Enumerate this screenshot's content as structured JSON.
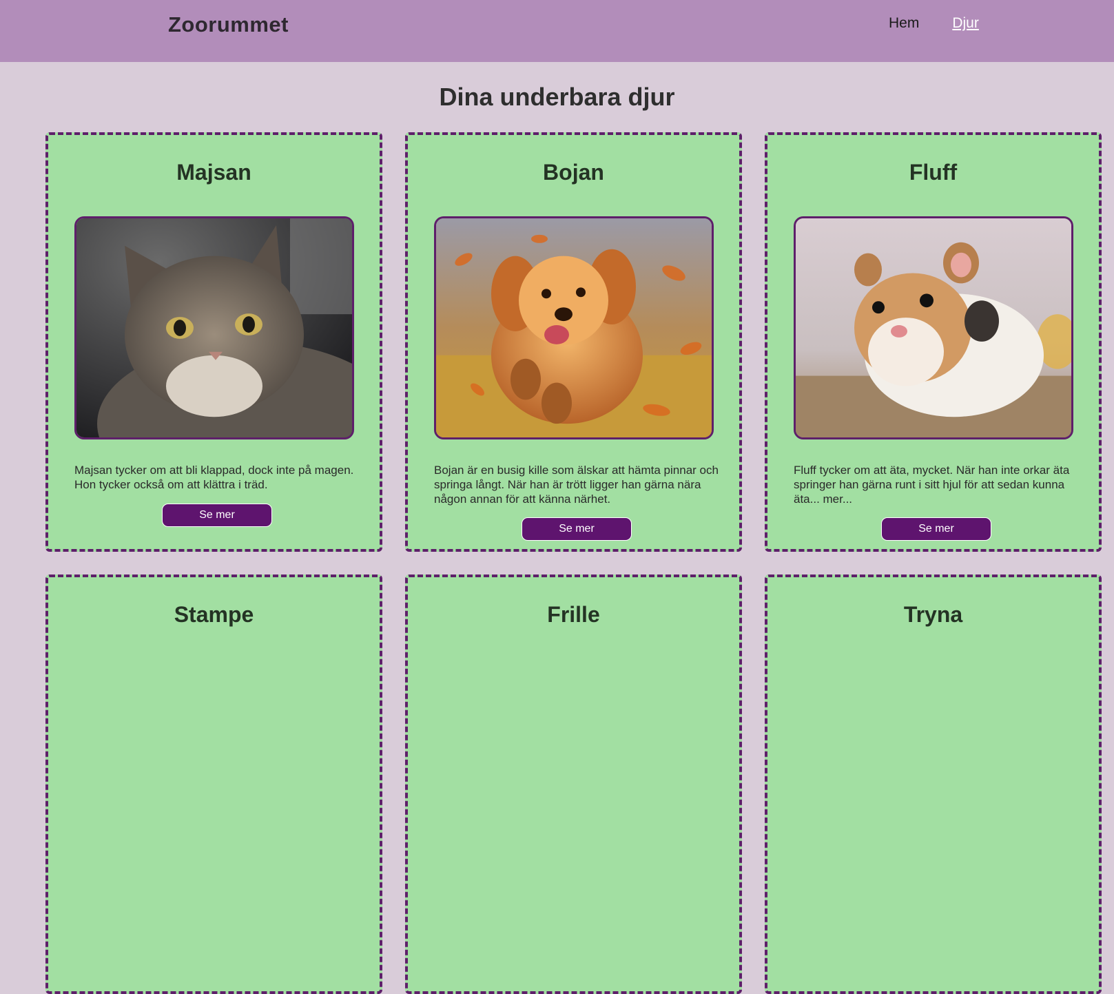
{
  "header": {
    "brand": "Zoorummet",
    "nav": [
      {
        "label": "Hem",
        "active": false
      },
      {
        "label": "Djur",
        "active": true
      }
    ]
  },
  "page": {
    "title": "Dina underbara djur"
  },
  "cards": [
    {
      "name": "Majsan",
      "description": "Majsan tycker om att bli klappad, dock inte på magen. Hon tycker också om att klättra i träd.",
      "button": "Se mer",
      "image": "cat-photo"
    },
    {
      "name": "Bojan",
      "description": "Bojan är en busig kille som älskar att hämta pinnar och springa långt. När han är trött ligger han gärna nära någon annan för att känna närhet.",
      "button": "Se mer",
      "image": "dog-photo"
    },
    {
      "name": "Fluff",
      "description": "Fluff tycker om att äta, mycket. När han inte orkar äta springer han gärna runt i sitt hjul för att sedan kunna äta... mer...",
      "button": "Se mer",
      "image": "hamster-photo"
    },
    {
      "name": "Stampe"
    },
    {
      "name": "Frille"
    },
    {
      "name": "Tryna"
    }
  ],
  "colors": {
    "header_bg": "#b28dba",
    "page_bg": "#d9ccd9",
    "card_bg": "#a2dfa2",
    "accent": "#5e146e"
  }
}
